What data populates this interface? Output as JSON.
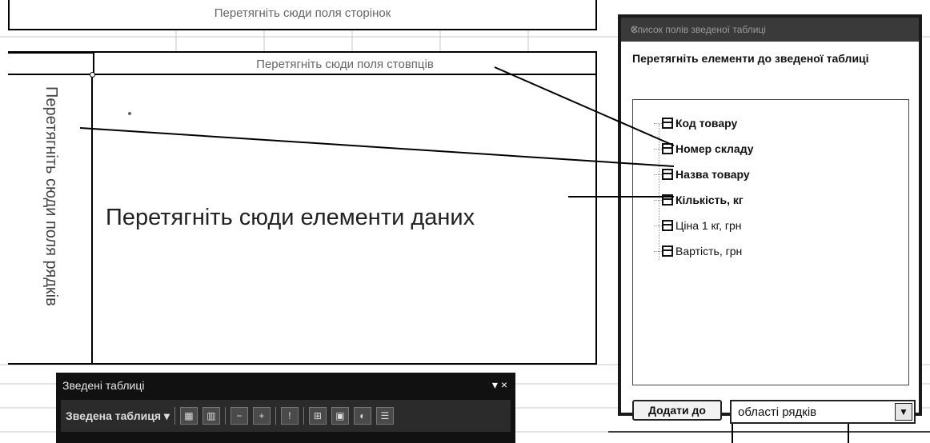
{
  "pivot_layout": {
    "page_zone_label": "Перетягніть сюди поля сторінок",
    "column_zone_label": "Перетягніть сюди поля стовпців",
    "row_zone_label": "Перетягніть сюди поля рядків",
    "data_zone_label": "Перетягніть сюди елементи даних"
  },
  "field_list": {
    "title": "Список полів зведеної таблиці",
    "close_icon": "close-icon",
    "instruction": "Перетягніть елементи до зведеної таблиці",
    "fields": [
      {
        "label": "Код товару"
      },
      {
        "label": "Номер складу"
      },
      {
        "label": "Назва товару"
      },
      {
        "label": "Кількість, кг"
      },
      {
        "label": "Ціна 1 кг, грн"
      },
      {
        "label": "Вартість, грн"
      }
    ],
    "add_button_label": "Додати до",
    "area_select_value": "області рядків"
  },
  "pivot_toolbar": {
    "title": "Зведені таблиці",
    "controls": "▾ ×",
    "menu_label": "Зведена таблиця ▾"
  }
}
